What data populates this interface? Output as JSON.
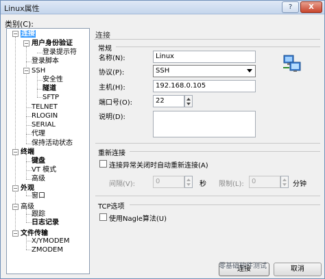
{
  "window": {
    "title": "Linux属性",
    "help_label": "?",
    "close_label": "X"
  },
  "category_label": "类别(C):",
  "tree": {
    "connection": "连接",
    "auth": "用户身份验证",
    "login_prompt": "登录提示符",
    "login_script": "登录脚本",
    "ssh": "SSH",
    "security": "安全性",
    "tunnel": "隧道",
    "sftp": "SFTP",
    "telnet": "TELNET",
    "rlogin": "RLOGIN",
    "serial": "SERIAL",
    "proxy": "代理",
    "keepalive": "保持活动状态",
    "terminal": "终端",
    "keyboard": "键盘",
    "vt_mode": "VT 模式",
    "terminal_advanced": "高级",
    "appearance": "外观",
    "window": "窗口",
    "advanced": "高级",
    "trace": "跟踪",
    "logging": "日志记录",
    "file_transfer": "文件传输",
    "xymodem": "X/YMODEM",
    "zmodem": "ZMODEM"
  },
  "panel": {
    "title": "连接",
    "general": {
      "group_label": "常规",
      "name_label": "名称(N):",
      "name_value": "Linux",
      "protocol_label": "协议(P):",
      "protocol_value": "SSH",
      "host_label": "主机(H):",
      "host_value": "192.168.0.105",
      "port_label": "端口号(O):",
      "port_value": "22",
      "desc_label": "说明(D):",
      "desc_value": ""
    },
    "reconnect": {
      "group_label": "重新连接",
      "checkbox_label": "连接异常关闭时自动重新连接(A)",
      "interval_label": "间隔(V):",
      "interval_value": "0",
      "interval_unit": "秒",
      "limit_label": "限制(L):",
      "limit_value": "0",
      "limit_unit": "分钟"
    },
    "tcp": {
      "group_label": "TCP选项",
      "nagle_label": "使用Nagle算法(U)"
    }
  },
  "footer": {
    "watermark": "零基础软件测试",
    "ok_label": "连接",
    "cancel_label": "取消"
  },
  "icons": {
    "monitor": "network-computer-icon"
  },
  "colors": {
    "selection": "#3399ff",
    "window_border": "#6f8fb8",
    "close_button": "#c9452c"
  }
}
